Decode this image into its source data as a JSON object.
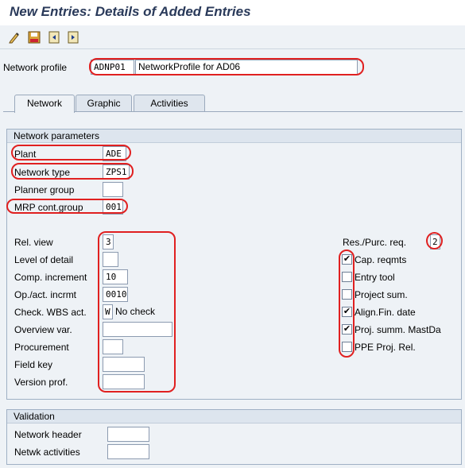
{
  "window": {
    "title": "New Entries: Details of Added Entries"
  },
  "toolbar": {
    "icons": [
      "change-icon",
      "save-icon",
      "previous-entry-icon",
      "next-entry-icon"
    ]
  },
  "header": {
    "network_profile_label": "Network profile",
    "network_profile_value": "ADNP01",
    "network_profile_description": "NetworkProfile  for AD06"
  },
  "tabs": [
    {
      "label": "Network",
      "active": true
    },
    {
      "label": "Graphic",
      "active": false
    },
    {
      "label": "Activities",
      "active": false
    }
  ],
  "network_parameters": {
    "title": "Network parameters",
    "plant_label": "Plant",
    "plant_value": "ADE",
    "network_type_label": "Network type",
    "network_type_value": "ZPS1",
    "planner_group_label": "Planner group",
    "planner_group_value": "",
    "mrp_label": "MRP cont.group",
    "mrp_value": "001",
    "rel_view_label": "Rel. view",
    "rel_view_value": "3",
    "level_of_detail_label": "Level of detail",
    "level_of_detail_value": "",
    "comp_increment_label": "Comp. increment",
    "comp_increment_value": "10",
    "op_incrmt_label": "Op./act. incrmt",
    "op_incrmt_value": "0010",
    "check_wbs_label": "Check. WBS act.",
    "check_wbs_value": "W",
    "check_wbs_description": "No check",
    "overview_var_label": "Overview var.",
    "overview_var_value": "",
    "procurement_label": "Procurement",
    "procurement_value": "",
    "field_key_label": "Field key",
    "field_key_value": "",
    "version_prof_label": "Version prof.",
    "version_prof_value": "",
    "res_purc_label": "Res./Purc. req.",
    "res_purc_value": "2",
    "checkboxes": [
      {
        "label": "Cap. reqmts",
        "checked": true
      },
      {
        "label": "Entry tool",
        "checked": false
      },
      {
        "label": "Project sum.",
        "checked": false
      },
      {
        "label": "Align.Fin. date",
        "checked": true
      },
      {
        "label": "Proj. summ. MastDa",
        "checked": true
      },
      {
        "label": "PPE Proj. Rel.",
        "checked": false
      }
    ]
  },
  "validation": {
    "title": "Validation",
    "network_header_label": "Network header",
    "network_header_value": "",
    "netwk_activities_label": "Netwk activities",
    "netwk_activities_value": ""
  },
  "colors": {
    "highlight": "#e02020",
    "panel": "#eef2f6"
  }
}
